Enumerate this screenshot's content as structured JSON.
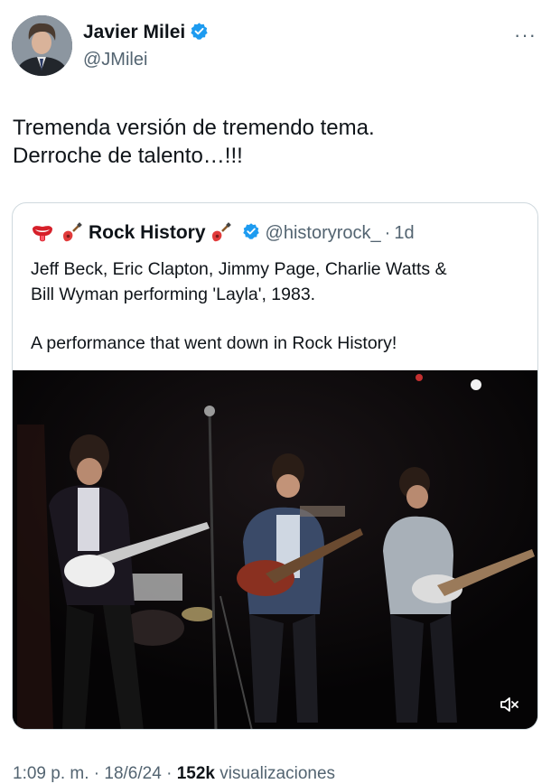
{
  "author": {
    "name": "Javier Milei",
    "handle": "@JMilei"
  },
  "tweet": {
    "lines": [
      "Tremenda versión de tremendo tema.",
      "Derroche de talento…!!!"
    ]
  },
  "quoted": {
    "name": "Rock History",
    "handle": "@historyrock_",
    "separator": "·",
    "time": "1d",
    "text_lines": [
      "Jeff Beck, Eric Clapton, Jimmy Page, Charlie Watts &",
      "Bill Wyman performing 'Layla', 1983."
    ],
    "text_line_2": "A performance that went down in Rock History!",
    "emojis": [
      "rolling-stones-tongue-icon",
      "guitar-icon"
    ]
  },
  "meta": {
    "time": "1:09 p. m.",
    "sep1": " · ",
    "date": "18/6/24",
    "sep2": " · ",
    "views": "152k",
    "views_label": " visualizaciones"
  },
  "colors": {
    "accent": "#1d9bf0",
    "text": "#0f1419",
    "secondary": "#536471",
    "border": "#cfd9de"
  }
}
